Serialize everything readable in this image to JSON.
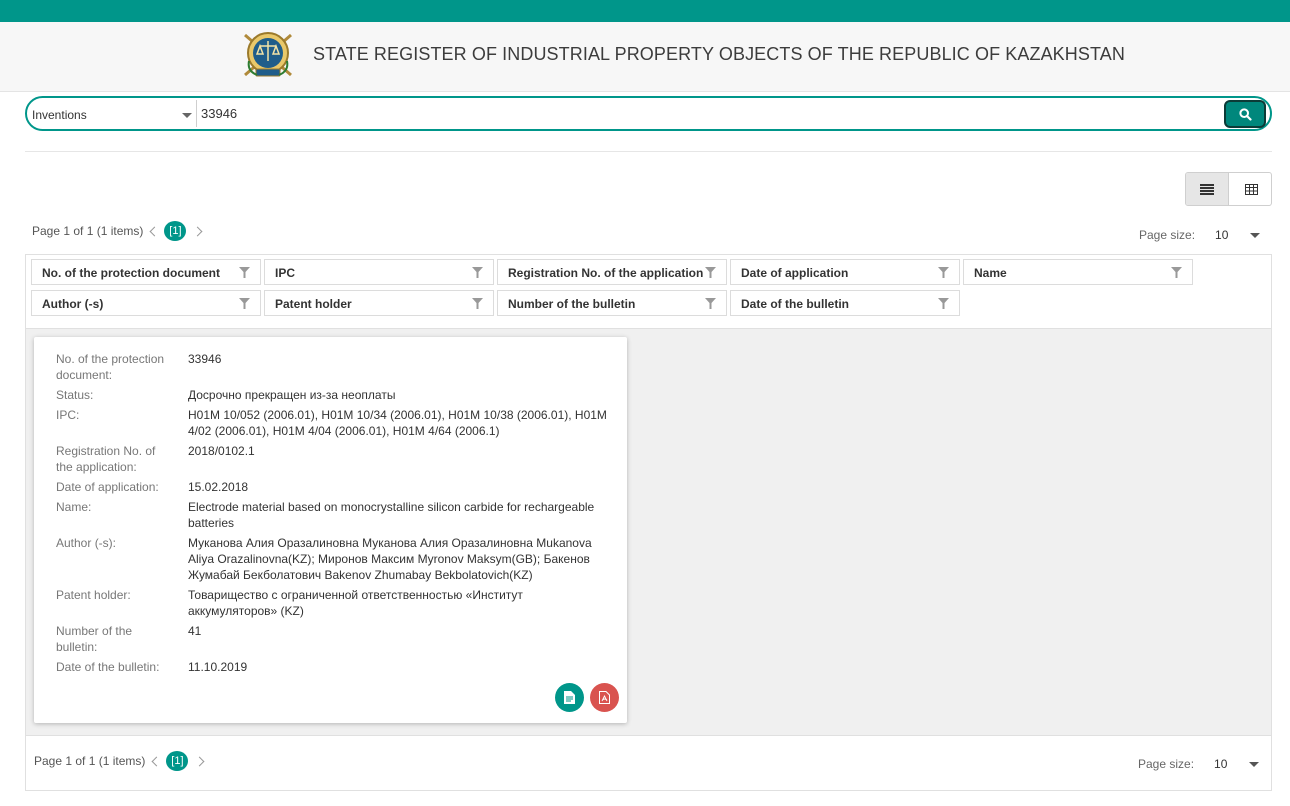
{
  "header": {
    "title": "STATE REGISTER OF INDUSTRIAL PROPERTY OBJECTS OF THE REPUBLIC OF KAZAKHSTAN"
  },
  "search": {
    "type_selected": "Inventions",
    "query": "33946"
  },
  "pager": {
    "info": "Page 1 of 1 (1 items)",
    "current": "[1]",
    "page_size_label": "Page size:",
    "page_size": "10"
  },
  "filters": [
    "No. of the protection document",
    "IPC",
    "Registration No. of the application",
    "Date of application",
    "Name",
    "Author (-s)",
    "Patent holder",
    "Number of the bulletin",
    "Date of the bulletin"
  ],
  "record": {
    "fields": [
      {
        "label": "No. of the protection document:",
        "value": "33946"
      },
      {
        "label": "Status:",
        "value": "Досрочно прекращен из-за неоплаты"
      },
      {
        "label": "IPC:",
        "value": "H01M 10/052 (2006.01), H01M 10/34 (2006.01), H01M 10/38 (2006.01), H01M 4/02 (2006.01), H01M 4/04 (2006.01), H01M 4/64 (2006.1)"
      },
      {
        "label": "Registration No. of the application:",
        "value": "2018/0102.1"
      },
      {
        "label": "Date of application:",
        "value": "15.02.2018"
      },
      {
        "label": "Name:",
        "value": "Electrode material based on monocrystalline silicon carbide for rechargeable batteries"
      },
      {
        "label": "Author (-s):",
        "value": "Муканова Алия Оразалиновна Муканова Алия Оразалиновна Mukanova Aliya Orazalinovna(KZ); Миронов Максим Myronov Maksym(GB); Бакенов Жумабай Бекболатович Bakenov Zhumabay Bekbolatovich(KZ)"
      },
      {
        "label": "Patent holder:",
        "value": "Товарищество с ограниченной ответственностью «Институт аккумуляторов» (KZ)"
      },
      {
        "label": "Number of the bulletin:",
        "value": "41"
      },
      {
        "label": "Date of the bulletin:",
        "value": "11.10.2019"
      }
    ]
  },
  "colors": {
    "accent": "#00968a",
    "pdf": "#d9534f"
  },
  "icons": [
    "emblem",
    "caret-down-icon",
    "search-icon",
    "list-view-icon",
    "grid-view-icon",
    "chevron-left-icon",
    "chevron-right-icon",
    "filter-icon",
    "document-icon",
    "pdf-icon"
  ]
}
